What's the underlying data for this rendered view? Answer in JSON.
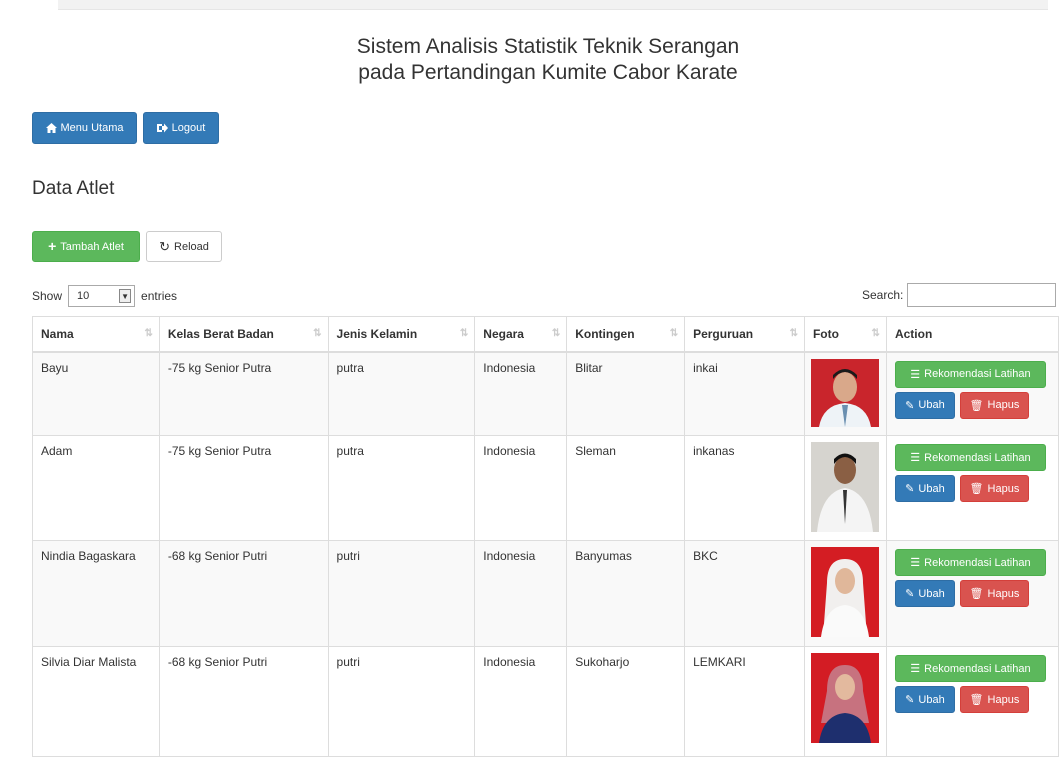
{
  "header": {
    "title_line1": "Sistem Analisis Statistik Teknik Serangan",
    "title_line2": "pada Pertandingan Kumite Cabor Karate"
  },
  "nav": {
    "menu_label": "Menu Utama",
    "logout_label": "Logout"
  },
  "section": {
    "title": "Data Atlet",
    "add_label": "Tambah Atlet",
    "reload_label": "Reload"
  },
  "table_controls": {
    "show_label": "Show",
    "entries_value": "10",
    "entries_label": "entries",
    "search_label": "Search:"
  },
  "columns": [
    "Nama",
    "Kelas Berat Badan",
    "Jenis Kelamin",
    "Negara",
    "Kontingen",
    "Perguruan",
    "Foto",
    "Action"
  ],
  "rows": [
    {
      "nama": "Bayu",
      "kelas": "-75 kg Senior Putra",
      "jk": "putra",
      "negara": "Indonesia",
      "kontingen": "Blitar",
      "perguruan": "inkai"
    },
    {
      "nama": "Adam",
      "kelas": "-75 kg Senior Putra",
      "jk": "putra",
      "negara": "Indonesia",
      "kontingen": "Sleman",
      "perguruan": "inkanas"
    },
    {
      "nama": "Nindia Bagaskara",
      "kelas": "-68 kg Senior Putri",
      "jk": "putri",
      "negara": "Indonesia",
      "kontingen": "Banyumas",
      "perguruan": "BKC"
    },
    {
      "nama": "Silvia Diar Malista",
      "kelas": "-68 kg Senior Putri",
      "jk": "putri",
      "negara": "Indonesia",
      "kontingen": "Sukoharjo",
      "perguruan": "LEMKARI"
    }
  ],
  "actions": {
    "recommend_label": "Rekomendasi Latihan",
    "edit_label": "Ubah",
    "delete_label": "Hapus"
  },
  "colors": {
    "primary": "#337ab7",
    "success": "#5cb85c",
    "danger": "#d9534f"
  }
}
